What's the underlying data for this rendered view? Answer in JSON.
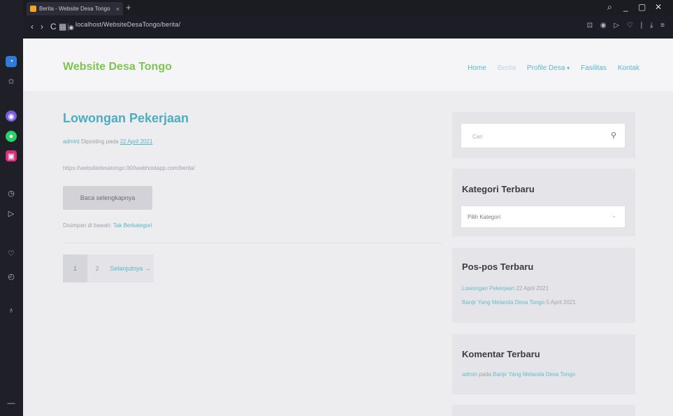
{
  "browser": {
    "tab_title": "Berita - Website Desa Tongo",
    "tab_close": "×",
    "new_tab": "+",
    "url": "localhost/WebsiteDesaTongo/berita/",
    "nav": {
      "back": "‹",
      "forward": "›",
      "reload": "C",
      "grid": "▦",
      "separator": "|",
      "site_info": "◉"
    },
    "window_controls": {
      "search": "⌕",
      "minimize": "_",
      "maximize": "▢",
      "close": "✕"
    },
    "toolbar_icons": "⊡ ◉ ▷ ♡ | ⤓ ≡",
    "sidebar_icons": [
      "messenger-icon",
      "whatsapp-icon",
      "instagram-icon",
      "clock-icon",
      "play-icon",
      "heart-icon",
      "history-icon",
      "bulb-icon"
    ]
  },
  "site": {
    "brand": "Website Desa Tongo",
    "menu": [
      "Home",
      "Berita",
      "Profile Desa",
      "Fasilitas",
      "Kontak"
    ],
    "menu_caret": "▾"
  },
  "post": {
    "title": "Lowongan Pekerjaan",
    "author": "admin",
    "meta_prefix": "| Diposting pada ",
    "date": "22 April 2021",
    "url": "https://websitedesatongo.000webhostapp.com/berita/",
    "read_more": "Baca selengkapnya",
    "filed_label": "Disimpan di bawah: ",
    "category": "Tak Berkategori"
  },
  "pagination": {
    "page1": "1",
    "page2": "2",
    "next": "Selanjutnya →"
  },
  "widgets": {
    "search_placeholder": "Cari",
    "kategori_title": "Kategori Terbaru",
    "kategori_select": "Pilih Kategori",
    "select_caret": "⌄",
    "pos_title": "Pos-pos Terbaru",
    "pos_items": [
      {
        "title": "Lowongan Pekerjaan",
        "date": " 22 April 2021"
      },
      {
        "title": "Banjir Yang Melanda Desa Tongo",
        "date": " 5 April 2021"
      }
    ],
    "komentar_title": "Komentar Terbaru",
    "komentar_author": "admin",
    "komentar_mid": " pada ",
    "komentar_post": "Banjir Yang Melanda Desa Tongo"
  },
  "colors": {
    "brand": "#7cc64f",
    "link": "#4aaec0",
    "opera_red": "#e8303b"
  }
}
